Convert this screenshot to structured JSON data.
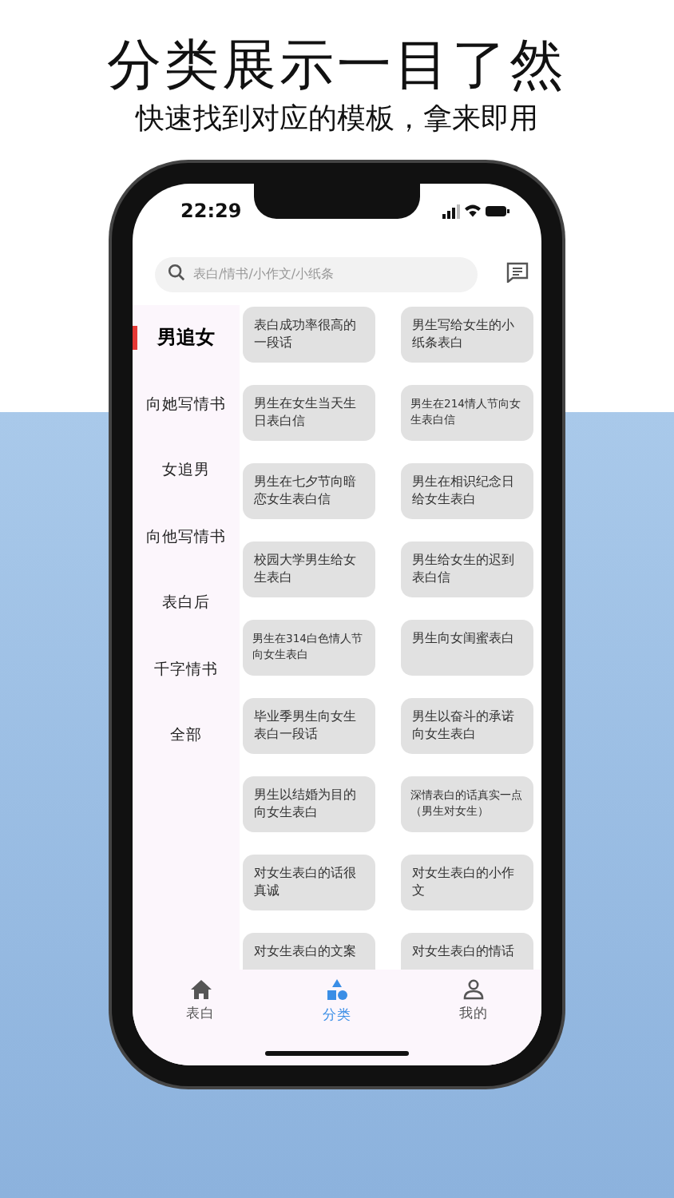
{
  "headline": "分类展示一目了然",
  "subheadline": "快速找到对应的模板，拿来即用",
  "status_bar": {
    "time": "22:29"
  },
  "search": {
    "placeholder": "表白/情书/小作文/小纸条"
  },
  "sidebar": {
    "items": [
      {
        "label": "男追女",
        "selected": true
      },
      {
        "label": "向她写情书",
        "selected": false
      },
      {
        "label": "女追男",
        "selected": false
      },
      {
        "label": "向他写情书",
        "selected": false
      },
      {
        "label": "表白后",
        "selected": false
      },
      {
        "label": "千字情书",
        "selected": false
      },
      {
        "label": "全部",
        "selected": false
      }
    ]
  },
  "cards": [
    {
      "text": "表白成功率很高的一段话",
      "kind": "normal"
    },
    {
      "text": "男生写给女生的小纸条表白",
      "kind": "normal"
    },
    {
      "text": "男生在女生当天生日表白信",
      "kind": "normal"
    },
    {
      "text": "男生在214情人节向女生表白信",
      "kind": "small"
    },
    {
      "text": "男生在七夕节向暗恋女生表白信",
      "kind": "normal"
    },
    {
      "text": "男生在相识纪念日给女生表白",
      "kind": "normal"
    },
    {
      "text": "校园大学男生给女生表白",
      "kind": "normal"
    },
    {
      "text": "男生给女生的迟到表白信",
      "kind": "normal"
    },
    {
      "text": "男生在314白色情人节向女生表白",
      "kind": "small"
    },
    {
      "text": "男生向女闺蜜表白",
      "kind": "normal"
    },
    {
      "text": "毕业季男生向女生表白一段话",
      "kind": "normal"
    },
    {
      "text": "男生以奋斗的承诺向女生表白",
      "kind": "normal"
    },
    {
      "text": "男生以结婚为目的向女生表白",
      "kind": "normal"
    },
    {
      "text": "深情表白的话真实一点（男生对女生）",
      "kind": "small"
    },
    {
      "text": "对女生表白的话很真诚",
      "kind": "normal"
    },
    {
      "text": "对女生表白的小作文",
      "kind": "normal"
    },
    {
      "text": "对女生表白的文案",
      "kind": "normal"
    },
    {
      "text": "对女生表白的情话",
      "kind": "normal"
    }
  ],
  "tabs": [
    {
      "label": "表白",
      "kind": "home",
      "selected": false
    },
    {
      "label": "分类",
      "kind": "shapes",
      "selected": true
    },
    {
      "label": "我的",
      "kind": "person",
      "selected": false
    }
  ]
}
